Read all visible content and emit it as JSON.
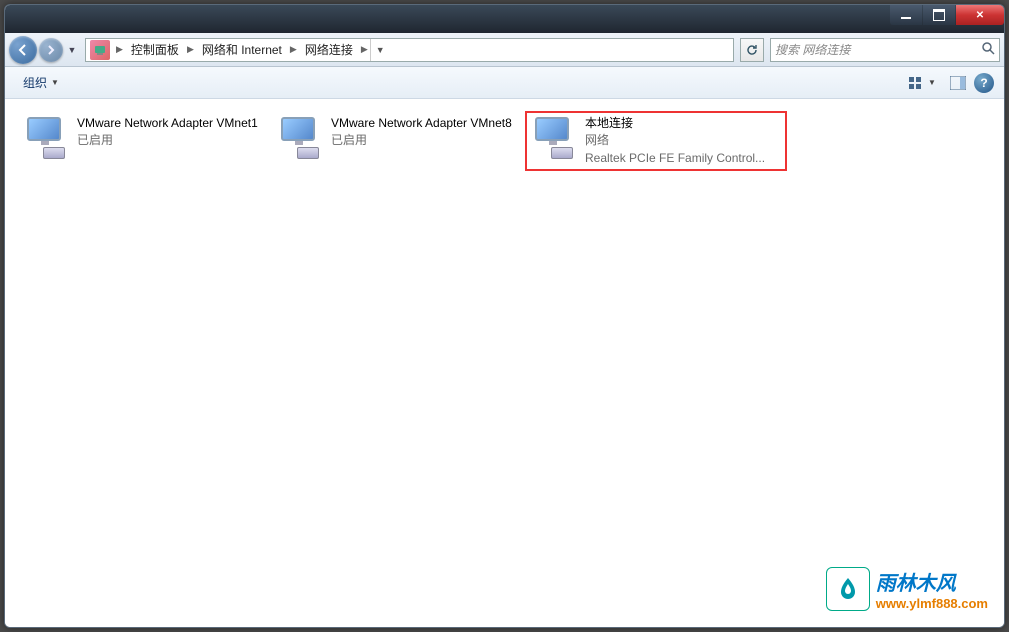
{
  "breadcrumbs": {
    "b1": "控制面板",
    "b2": "网络和 Internet",
    "b3": "网络连接"
  },
  "search": {
    "placeholder": "搜索 网络连接"
  },
  "toolbar": {
    "organize": "组织"
  },
  "adapters": {
    "a1": {
      "name": "VMware Network Adapter VMnet1",
      "status": "已启用"
    },
    "a2": {
      "name": "VMware Network Adapter VMnet8",
      "status": "已启用"
    },
    "a3": {
      "name": "本地连接",
      "net": "网络",
      "device": "Realtek PCIe FE Family Control..."
    }
  },
  "watermark": {
    "title": "雨林木风",
    "url": "www.ylmf888.com"
  }
}
